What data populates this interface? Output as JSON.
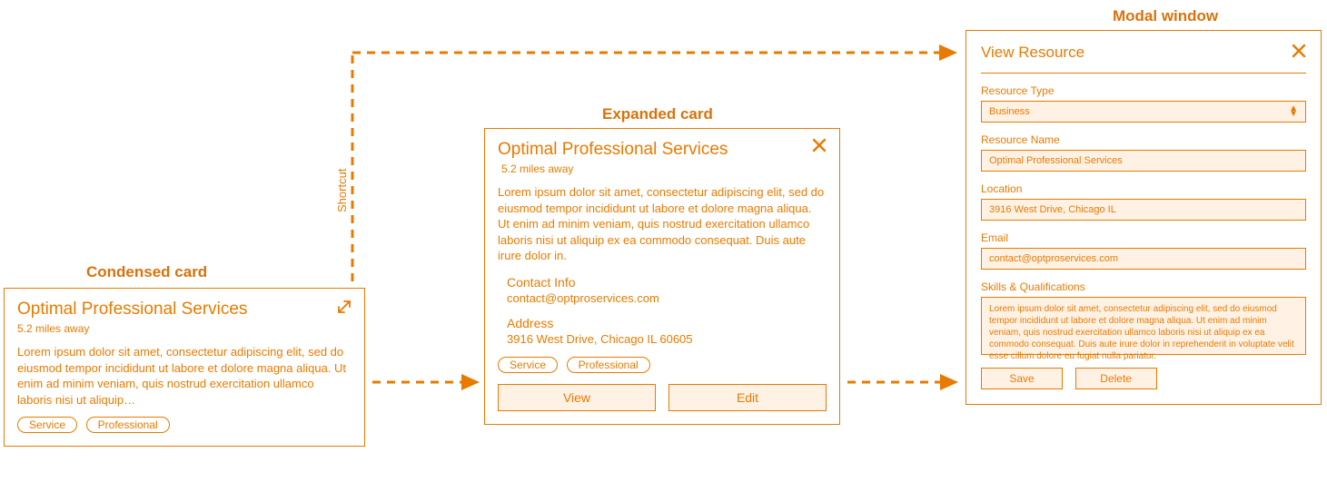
{
  "labels": {
    "condensed": "Condensed card",
    "expanded": "Expanded card",
    "modal": "Modal window",
    "shortcut": "Shortcut"
  },
  "condensed": {
    "title": "Optimal Professional Services",
    "distance": "5.2 miles away",
    "desc": "Lorem ipsum dolor sit amet, consectetur adipiscing elit, sed do eiusmod tempor incididunt ut labore et dolore magna aliqua. Ut enim ad minim veniam, quis nostrud exercitation ullamco laboris nisi ut aliquip…",
    "tags": [
      "Service",
      "Professional"
    ]
  },
  "expanded": {
    "title": "Optimal Professional Services",
    "distance": "5.2 miles away",
    "desc": "Lorem ipsum dolor sit amet, consectetur adipiscing elit, sed do eiusmod tempor incididunt ut labore et dolore magna aliqua. Ut enim ad minim veniam, quis nostrud exercitation ullamco laboris nisi ut aliquip ex ea commodo consequat. Duis aute irure dolor in.",
    "contact_label": "Contact Info",
    "contact_value": "contact@optproservices.com",
    "address_label": "Address",
    "address_value": "3916 West Drive, Chicago IL 60605",
    "tags": [
      "Service",
      "Professional"
    ],
    "view_btn": "View",
    "edit_btn": "Edit"
  },
  "modal": {
    "header": "View Resource",
    "resource_type_label": "Resource Type",
    "resource_type_value": "Business",
    "resource_name_label": "Resource Name",
    "resource_name_value": "Optimal Professional Services",
    "location_label": "Location",
    "location_value": "3916 West Drive, Chicago IL",
    "email_label": "Email",
    "email_value": "contact@optproservices.com",
    "skills_label": "Skills & Qualifications",
    "skills_value": "Lorem ipsum dolor sit amet, consectetur adipiscing elit, sed do eiusmod tempor incididunt ut labore et dolore magna aliqua. Ut enim ad minim veniam, quis nostrud exercitation ullamco laboris nisi ut aliquip ex ea commodo consequat. Duis aute irure dolor in reprehenderit in voluptate velit esse cillum dolore eu fugiat nulla pariatur.",
    "save_btn": "Save",
    "delete_btn": "Delete"
  }
}
